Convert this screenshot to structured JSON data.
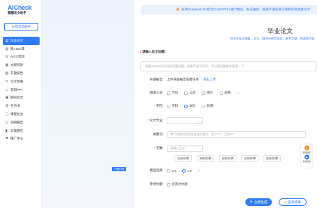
{
  "sidebar": {
    "logo_brand": "AICheck",
    "logo_sub": "圈圈论文助手",
    "new_button": "新对话助手",
    "items": [
      {
        "label": "毕业论文",
        "icon": "document-icon",
        "active": true
      },
      {
        "label": "降AIGC率",
        "icon": "chart-icon",
        "active": false
      },
      {
        "label": "AIGC检测",
        "icon": "scan-icon",
        "active": false
      },
      {
        "label": "文献综述",
        "icon": "book-icon",
        "active": false
      },
      {
        "label": "开题报告",
        "icon": "report-icon",
        "active": false
      },
      {
        "label": "论文降重",
        "icon": "edit-icon",
        "active": false
      },
      {
        "label": "答辩PPT",
        "icon": "ppt-icon",
        "active": false
      },
      {
        "label": "期刊论文",
        "icon": "journal-icon",
        "active": false
      },
      {
        "label": "任务书",
        "icon": "task-icon",
        "active": false
      },
      {
        "label": "课程论文",
        "icon": "course-icon",
        "active": false
      },
      {
        "label": "调研报告",
        "icon": "survey-icon",
        "active": false
      },
      {
        "label": "实践报告",
        "icon": "practice-icon",
        "active": false
      },
      {
        "label": "推广中心",
        "icon": "promo-icon",
        "active": false
      }
    ]
  },
  "mid": {
    "tag": "下载中间"
  },
  "main": {
    "banner": "采用Deepseek R1结合ChatGPT4o进行精准，生成通顺、逻辑严谨且易于理解的高质量论文",
    "title": "毕业论文",
    "subtitle": "包含中英文摘要、正文、国内外研究现状、参考文献、致谢等内容",
    "section_label": "请输入论文标题：",
    "title_placeholder": "请输入5-50字以内的完整标题，如果不会写可以：可以用选题助手查看一下",
    "upload": {
      "label": "开题报告:",
      "text": "上传开题报告或者任务",
      "link": "点击上传"
    },
    "charts": {
      "label": "图表公式:",
      "options": [
        "代码",
        "公式",
        "图片",
        "表格"
      ]
    },
    "degree": {
      "label": "学历:",
      "options": [
        "专科",
        "本科",
        "硕博"
      ],
      "selected": 1
    },
    "major": {
      "label": "论文专业:"
    },
    "keywords": {
      "label": "关键词:",
      "placeholder": "每个关键词用空格或逗号隔开，至少3个，至多8个"
    },
    "words": {
      "label": "字数:",
      "placeholder": "请输入正文",
      "options": [
        "10000字",
        "20000字",
        "30000字",
        "40000字",
        "50000字"
      ]
    },
    "model": {
      "label": "模型选择:",
      "options": [
        "3.0",
        "4.0"
      ],
      "selected": 1
    },
    "refs": {
      "label": "参考文献:",
      "option": "含英文文献"
    },
    "float": {
      "top": "联系客服",
      "bottom": "查看帮助"
    },
    "btn_generate": "立即生成",
    "btn_query": "查询结果"
  }
}
